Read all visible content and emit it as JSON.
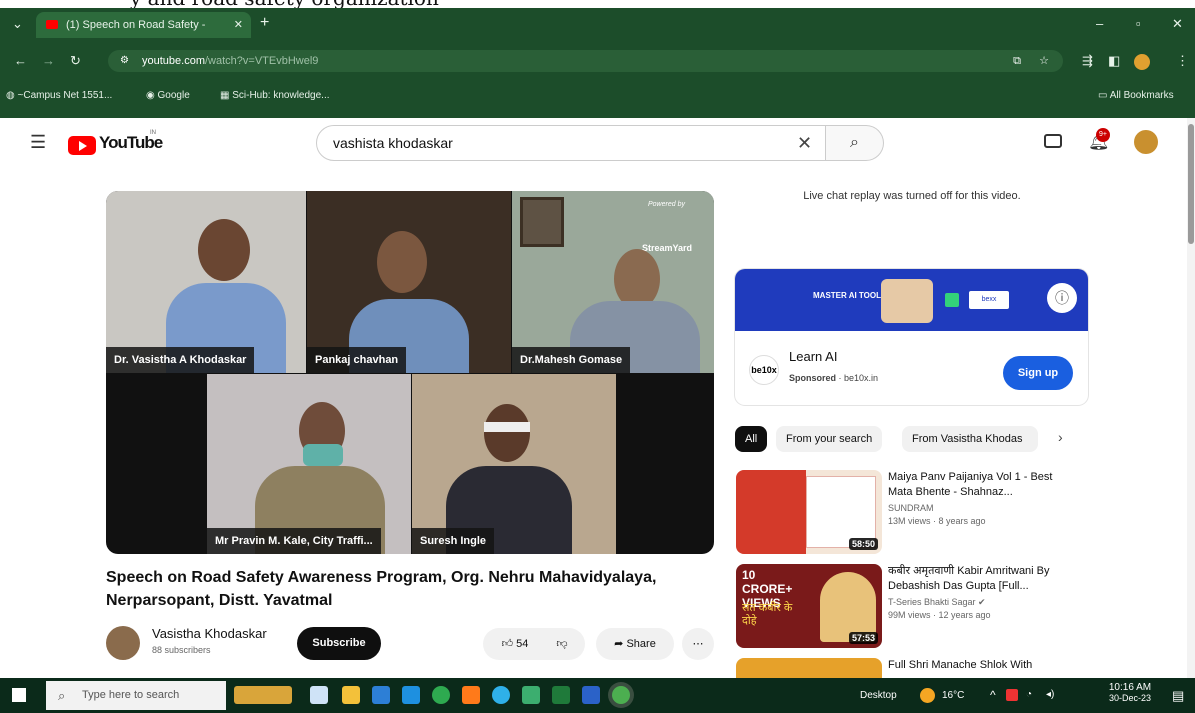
{
  "caption": "y and road safety organization",
  "browser": {
    "tab_title": "(1) Speech on Road Safety - ",
    "url_host": "youtube.com",
    "url_path": "/watch?v=VTEvbHwel9",
    "bookmarks": [
      "~Campus Net 1551...",
      "Google",
      "Sci-Hub: knowledge...",
      "All Bookmarks"
    ]
  },
  "youtube": {
    "logo_text": "YouTube",
    "logo_sup": "IN",
    "search_value": "vashista khodaskar",
    "notification_count": "9+"
  },
  "video": {
    "powered_by": "Powered by",
    "brand": "StreamYard",
    "participants": [
      "Dr. Vasistha A Khodaskar",
      "Pankaj chavhan",
      "Dr.Mahesh Gomase",
      "Mr Pravin M. Kale, City Traffi...",
      "Suresh Ingle"
    ],
    "title": "Speech on Road Safety Awareness Program, Org. Nehru Mahavidyalaya, Nerparsopant, Distt. Yavatmal",
    "channel": "Vasistha Khodaskar",
    "subscribers": "88 subscribers",
    "subscribe_label": "Subscribe",
    "likes": "54",
    "share_label": "Share"
  },
  "chat_notice": "Live chat replay was turned off for this video.",
  "ad": {
    "logo": "be10x",
    "banner_a": "MASTER AI TOOLS",
    "banner_b": "bexx",
    "title": "Learn AI",
    "sponsored": "Sponsored",
    "domain": "be10x.in",
    "cta": "Sign up"
  },
  "chips": [
    "All",
    "From your search",
    "From Vasistha Khodas"
  ],
  "related": [
    {
      "title": "Maiya Panv Paijaniya Vol 1 - Best Mata Bhente - Shahnaz...",
      "channel": "SUNDRAM",
      "meta": "13M views · 8 years ago",
      "duration": "58:50",
      "thumb_text": ""
    },
    {
      "title": "कबीर अमृतवाणी Kabir Amritwani By Debashish Das Gupta [Full...",
      "channel": "T-Series Bhakti Sagar ✔",
      "meta": "99M views · 12 years ago",
      "duration": "57:53",
      "thumb_text": "10 CRORE+ VIEWS",
      "thumb_text2": "संत कबीर के दोहे"
    },
    {
      "title": "Full Shri Manache Shlok With",
      "channel": "",
      "meta": "",
      "duration": "",
      "thumb_text": ""
    }
  ],
  "taskbar": {
    "search_placeholder": "Type here to search",
    "desktop_label": "Desktop",
    "temperature": "16°C",
    "time": "10:16 AM",
    "date": "30-Dec-23"
  },
  "colors": {
    "chrome": "#1c4d2a",
    "yt_red": "#ff0000",
    "ad_blue": "#1f3bbd",
    "cta_blue": "#1a5fe0"
  }
}
